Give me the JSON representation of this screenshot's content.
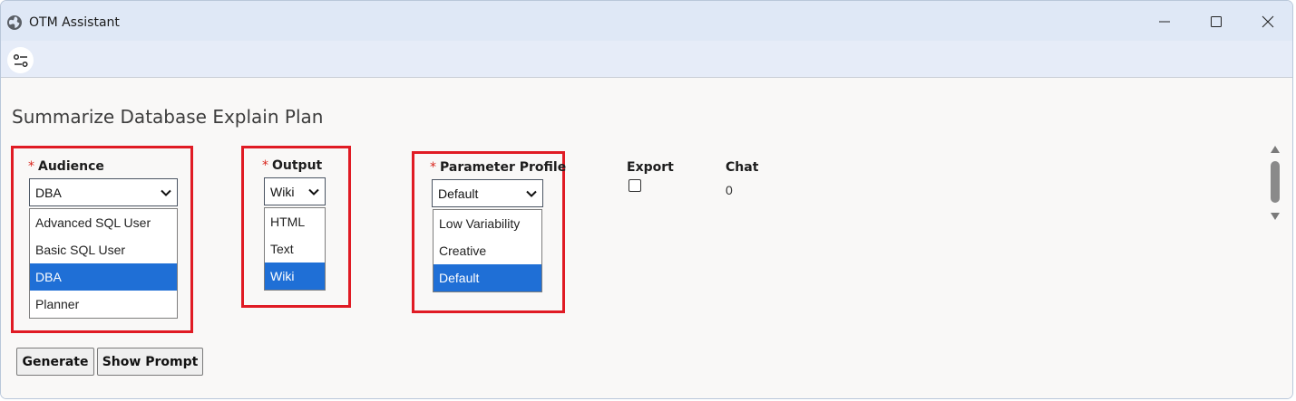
{
  "window": {
    "title": "OTM Assistant",
    "app_icon": "globe-icon",
    "controls": [
      "minimize-icon",
      "maximize-icon",
      "close-icon"
    ]
  },
  "toolbar": {
    "settings_icon": "settings-sliders-icon"
  },
  "page": {
    "title": "Summarize Database Explain Plan"
  },
  "fields": {
    "audience": {
      "label": "Audience",
      "required_mark": "*",
      "selected": "DBA",
      "options": [
        "Advanced SQL User",
        "Basic SQL User",
        "DBA",
        "Planner"
      ],
      "selected_index": 2
    },
    "output": {
      "label": "Output",
      "required_mark": "*",
      "selected": "Wiki",
      "options": [
        "HTML",
        "Text",
        "Wiki"
      ],
      "selected_index": 2
    },
    "parameter_profile": {
      "label": "Parameter Profile",
      "required_mark": "*",
      "selected": "Default",
      "options": [
        "Low Variability",
        "Creative",
        "Default"
      ],
      "selected_index": 2
    },
    "export": {
      "label": "Export",
      "checked": false
    },
    "chat": {
      "label": "Chat",
      "value": "0"
    }
  },
  "buttons": {
    "generate": "Generate",
    "show_prompt": "Show Prompt"
  },
  "colors": {
    "highlight": "#e01b24",
    "selected": "#1f6fd6",
    "titlebar": "#dfe8f6"
  }
}
